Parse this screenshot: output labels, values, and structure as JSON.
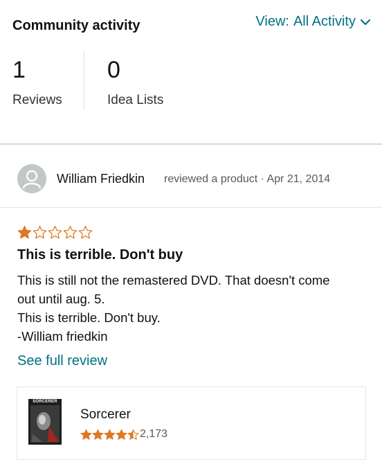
{
  "header": {
    "title": "Community activity",
    "view_label": "View:",
    "view_value": "All Activity"
  },
  "stats": [
    {
      "value": "1",
      "label": "Reviews"
    },
    {
      "value": "0",
      "label": "Idea Lists"
    }
  ],
  "activity": {
    "author": "William Friedkin",
    "action": "reviewed a product · Apr 21, 2014"
  },
  "review": {
    "rating": 1,
    "max_rating": 5,
    "title": "This is terrible. Don't buy",
    "body_lines": [
      "This is still not the remastered DVD. That doesn't come",
      "out until aug. 5.",
      "This is terrible. Don't buy.",
      "-William friedkin"
    ],
    "see_full": "See full review"
  },
  "product": {
    "name": "Sorcerer",
    "cover_text": "SORCERER",
    "rating": 4.5,
    "rating_count": "2,173"
  },
  "colors": {
    "link": "#007185",
    "star": "#de7921",
    "muted_text": "#565959"
  }
}
